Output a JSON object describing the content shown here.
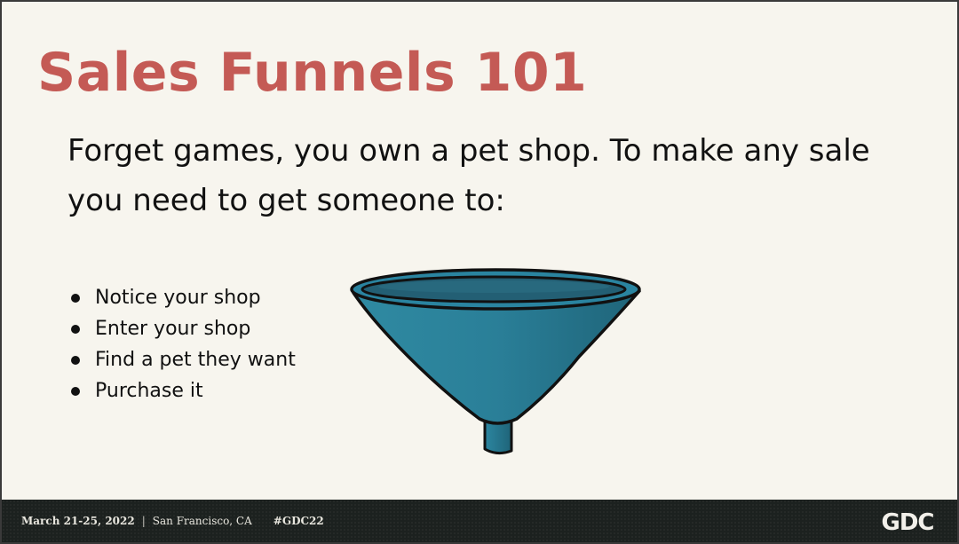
{
  "slide": {
    "title": "Sales Funnels 101",
    "intro": "Forget games, you own a pet shop. To make any sale you need to get someone to:",
    "bullets": [
      "Notice your shop",
      "Enter your shop",
      "Find a pet they want",
      "Purchase it"
    ]
  },
  "footer": {
    "date": "March 21-25, 2022",
    "separator": "|",
    "location": "San Francisco, CA",
    "hashtag": "#GDC22",
    "logo_text": "GDC"
  },
  "colors": {
    "title": "#c45a55",
    "background": "#f7f5ee",
    "funnel": "#2a7d95",
    "footer": "#1c211f"
  }
}
